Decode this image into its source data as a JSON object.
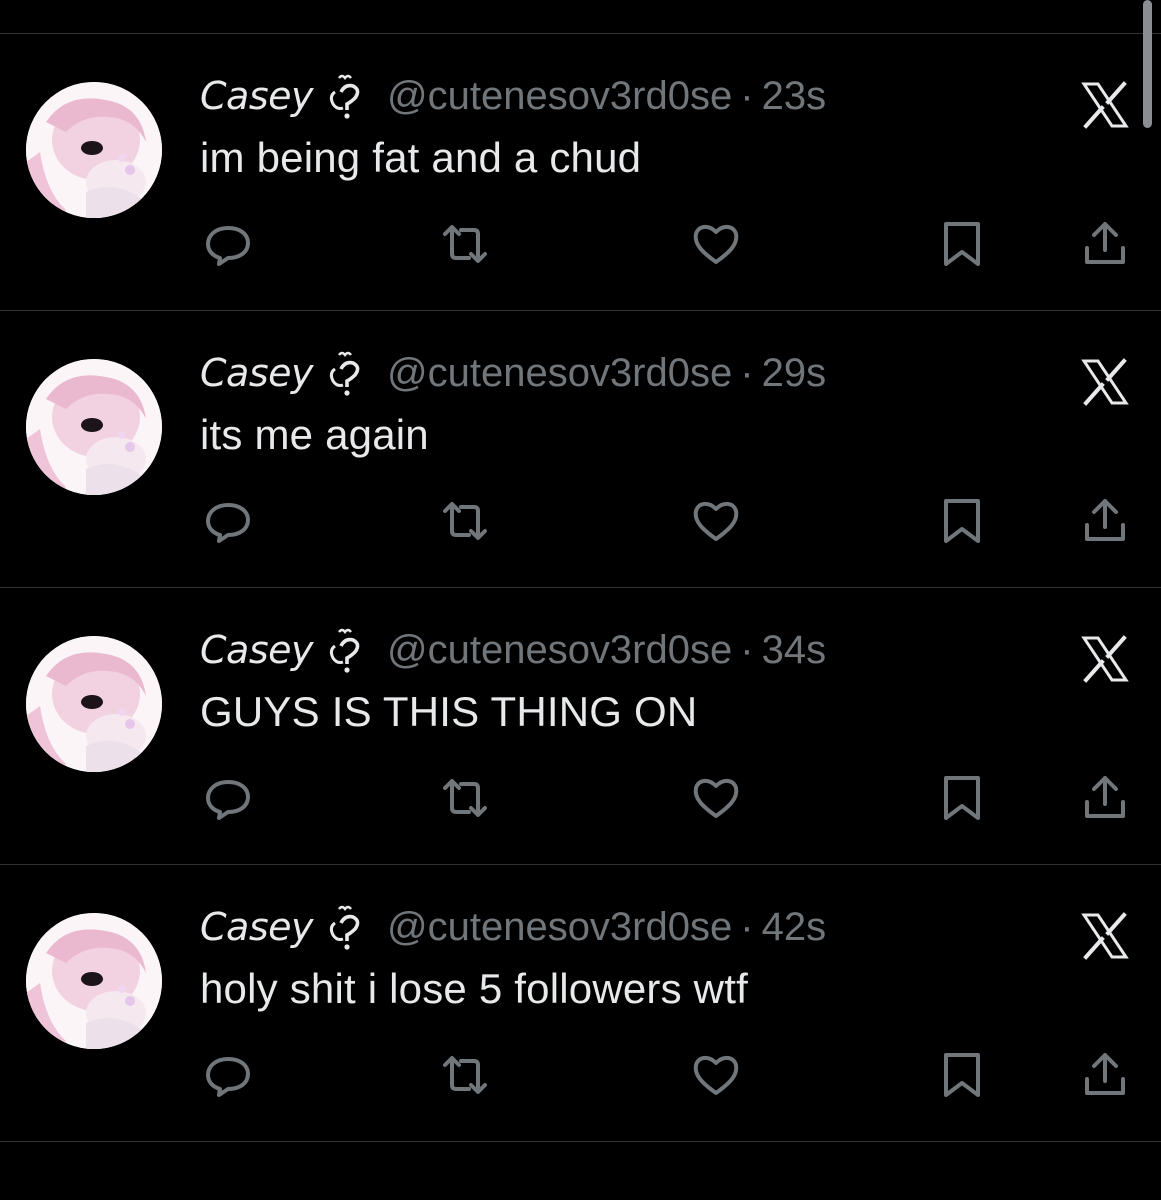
{
  "tweets": [
    {
      "display_name": "Casey",
      "name_emoji": "heart-shaped-question-with-cat-ear-emoji",
      "handle": "@cutenesov3rd0se",
      "separator": "·",
      "time": "23s",
      "text": "im being fat and a chud"
    },
    {
      "display_name": "Casey",
      "name_emoji": "heart-shaped-question-with-cat-ear-emoji",
      "handle": "@cutenesov3rd0se",
      "separator": "·",
      "time": "29s",
      "text": "its me again"
    },
    {
      "display_name": "Casey",
      "name_emoji": "heart-shaped-question-with-cat-ear-emoji",
      "handle": "@cutenesov3rd0se",
      "separator": "·",
      "time": "34s",
      "text": "GUYS IS THIS THING ON"
    },
    {
      "display_name": "Casey",
      "name_emoji": "heart-shaped-question-with-cat-ear-emoji",
      "handle": "@cutenesov3rd0se",
      "separator": "·",
      "time": "42s",
      "text": "holy shit i lose 5 followers wtf"
    }
  ],
  "icons": {
    "grok": "grok-x-icon",
    "reply": "reply-icon",
    "retweet": "retweet-icon",
    "like": "heart-icon",
    "bookmark": "bookmark-icon",
    "share": "share-icon"
  },
  "colors": {
    "background": "#000000",
    "primary_text": "#e7e9ea",
    "secondary_text": "#71767b",
    "divider": "#2f3336",
    "avatar_bg": "#fbf5f8"
  }
}
